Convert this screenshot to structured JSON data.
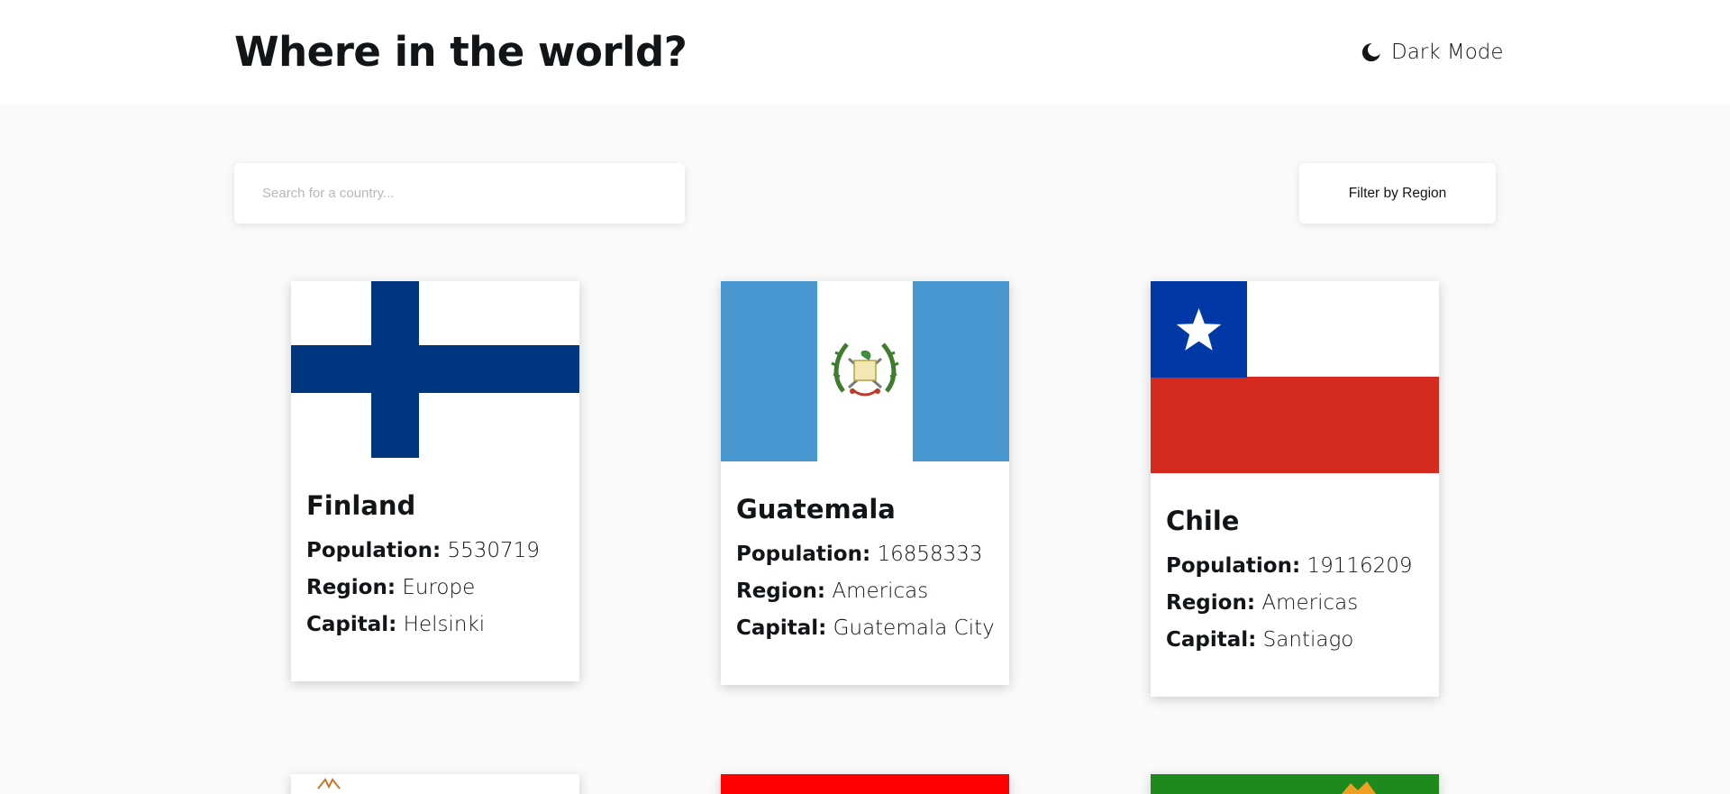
{
  "header": {
    "title": "Where in the world?",
    "theme_toggle": {
      "label": "Dark Mode",
      "icon": "moon-icon"
    }
  },
  "search": {
    "placeholder": "Search for a country...",
    "value": "",
    "icon": "search-icon"
  },
  "filter": {
    "label": "Filter by Region"
  },
  "labels": {
    "population": "Population:",
    "region": "Region:",
    "capital": "Capital:"
  },
  "countries": [
    {
      "name": "Finland",
      "population": "5530719",
      "region": "Europe",
      "capital": "Helsinki",
      "flag_icon": "finland-flag-icon"
    },
    {
      "name": "Guatemala",
      "population": "16858333",
      "region": "Americas",
      "capital": "Guatemala City",
      "flag_icon": "guatemala-flag-icon"
    },
    {
      "name": "Chile",
      "population": "19116209",
      "region": "Americas",
      "capital": "Santiago",
      "flag_icon": "chile-flag-icon"
    }
  ],
  "colors": {
    "background": "#fafafa",
    "surface": "#ffffff",
    "text": "#111517",
    "finland_blue": "#003580",
    "guatemala_blue": "#4997d0",
    "chile_blue": "#0039a6",
    "chile_red": "#d52b1e"
  }
}
